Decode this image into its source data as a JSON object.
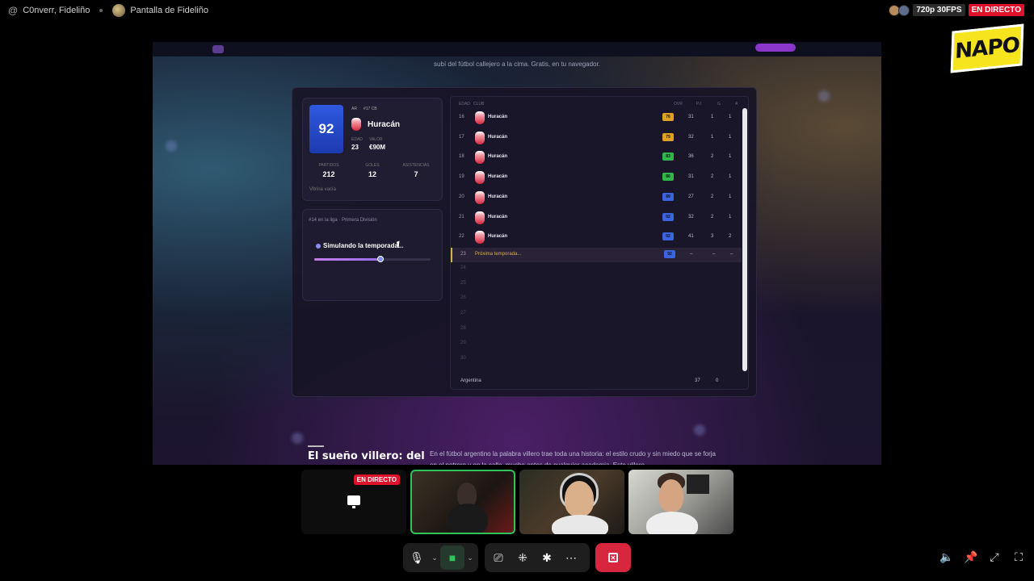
{
  "topbar": {
    "user": "C0nverr, Fideliño",
    "screen_name": "Pantalla de Fideliño",
    "quality": "720p 30FPS",
    "live": "EN DIRECTO"
  },
  "logo": "NAPO",
  "site": {
    "tagline": "subí del fútbol callejero a la cima. Gratis, en tu navegador."
  },
  "player": {
    "rating": "92",
    "meta_nat": "AR",
    "meta_pos": "#17 CB",
    "club": "Huracán",
    "age_label": "EDAD",
    "age": "23",
    "value_label": "VALOR",
    "value": "€90M",
    "stats": [
      {
        "label": "PARTIDOS",
        "value": "212"
      },
      {
        "label": "GOLES",
        "value": "12"
      },
      {
        "label": "ASISTENCIAS",
        "value": "7"
      }
    ],
    "vitrina": "Vitrina vacía"
  },
  "season": {
    "league": "#14 en la liga · Primera División",
    "status": "Simulando la temporada...",
    "progress_fraction": 0.57
  },
  "career": {
    "headers": {
      "age": "EDAD",
      "club": "CLUB",
      "ovr": "OVR",
      "pj": "PJ",
      "g": "G",
      "a": "A"
    },
    "rows": [
      {
        "age": "16",
        "club": "Huracán",
        "ovr": "76",
        "color": "#e0a020",
        "pj": "31",
        "g": "1",
        "a": "1"
      },
      {
        "age": "17",
        "club": "Huracán",
        "ovr": "79",
        "color": "#e0a020",
        "pj": "32",
        "g": "1",
        "a": "1"
      },
      {
        "age": "18",
        "club": "Huracán",
        "ovr": "83",
        "color": "#2fb84a",
        "pj": "36",
        "g": "2",
        "a": "1"
      },
      {
        "age": "19",
        "club": "Huracán",
        "ovr": "86",
        "color": "#2fb84a",
        "pj": "31",
        "g": "2",
        "a": "1"
      },
      {
        "age": "20",
        "club": "Huracán",
        "ovr": "89",
        "color": "#3a64e0",
        "pj": "27",
        "g": "2",
        "a": "1"
      },
      {
        "age": "21",
        "club": "Huracán",
        "ovr": "92",
        "color": "#3a64e0",
        "pj": "32",
        "g": "2",
        "a": "1"
      },
      {
        "age": "22",
        "club": "Huracán",
        "ovr": "92",
        "color": "#3a64e0",
        "pj": "41",
        "g": "3",
        "a": "2"
      }
    ],
    "next": {
      "age": "23",
      "label": "Próxima temporada...",
      "ovr": "92",
      "pj": "–",
      "g": "–",
      "a": "–"
    },
    "empty_ages": [
      "24",
      "25",
      "26",
      "27",
      "28",
      "29",
      "30"
    ],
    "footer": {
      "country": "Argentina",
      "pj": "37",
      "g": "0"
    }
  },
  "article": {
    "heading": "El sueño villero: del",
    "paragraph": "En el fútbol argentino la palabra villero trae toda una historia: el estilo crudo y sin miedo que se forja en el potrero y en la calle, mucho antes de cualquier academia. Este villero"
  },
  "tiles": {
    "live_tag": "EN DIRECTO"
  }
}
